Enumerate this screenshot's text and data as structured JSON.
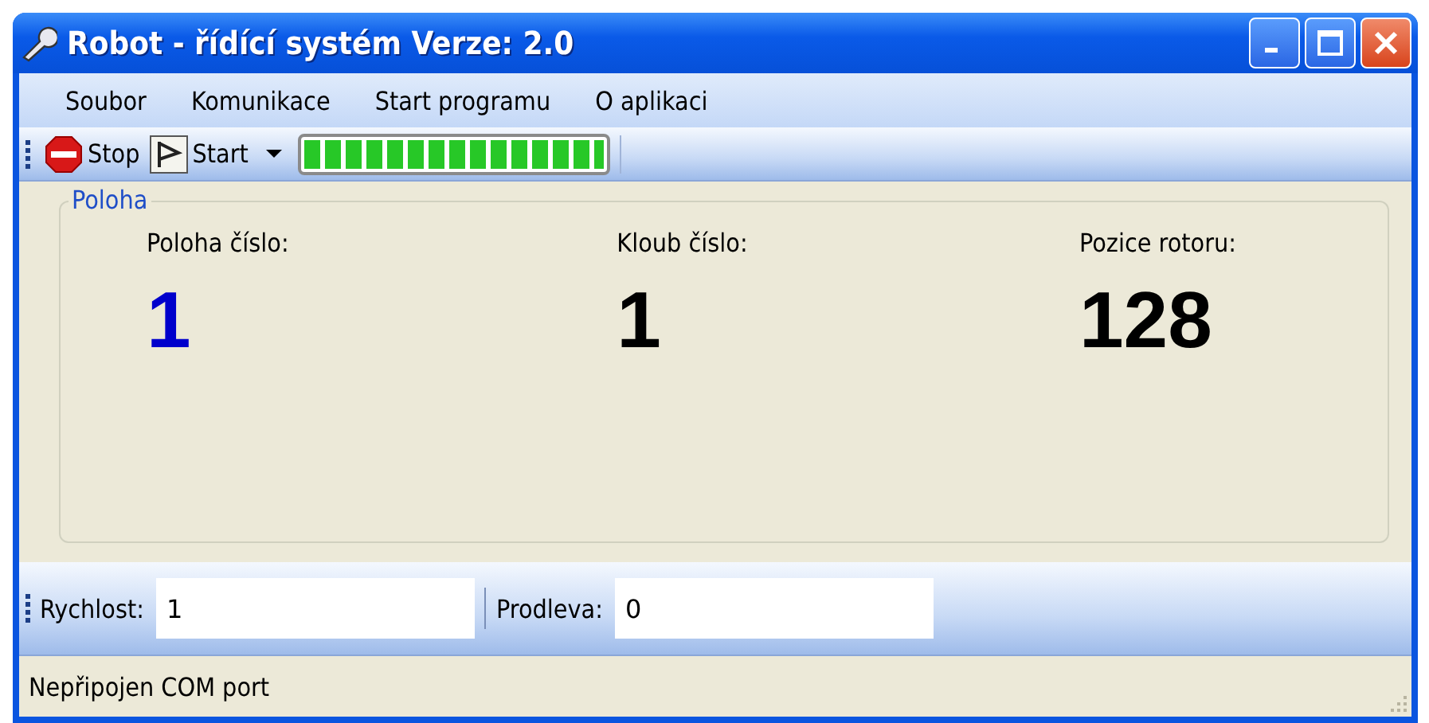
{
  "window": {
    "title": "Robot - řídící systém Verze: 2.0"
  },
  "menu": [
    "Soubor",
    "Komunikace",
    "Start programu",
    "O aplikaci"
  ],
  "toolbar": {
    "buttons": [
      {
        "kind": "stop",
        "label": "Stop"
      },
      {
        "kind": "start",
        "label": "Start"
      }
    ],
    "progress": {
      "level": 1
    }
  },
  "group": {
    "title": "Poloha",
    "readouts": [
      {
        "label": "Poloha číslo:",
        "value": "1",
        "color": "#0000cc"
      },
      {
        "label": "Kloub číslo:",
        "value": "1",
        "color": "#000000"
      },
      {
        "label": "Pozice rotoru:",
        "value": "128",
        "color": "#000000"
      }
    ]
  },
  "params": [
    {
      "label": "Rychlost:",
      "value": "1"
    },
    {
      "label": "Prodleva:",
      "value": "0"
    }
  ],
  "status_bar": "Nepřipojen COM port"
}
